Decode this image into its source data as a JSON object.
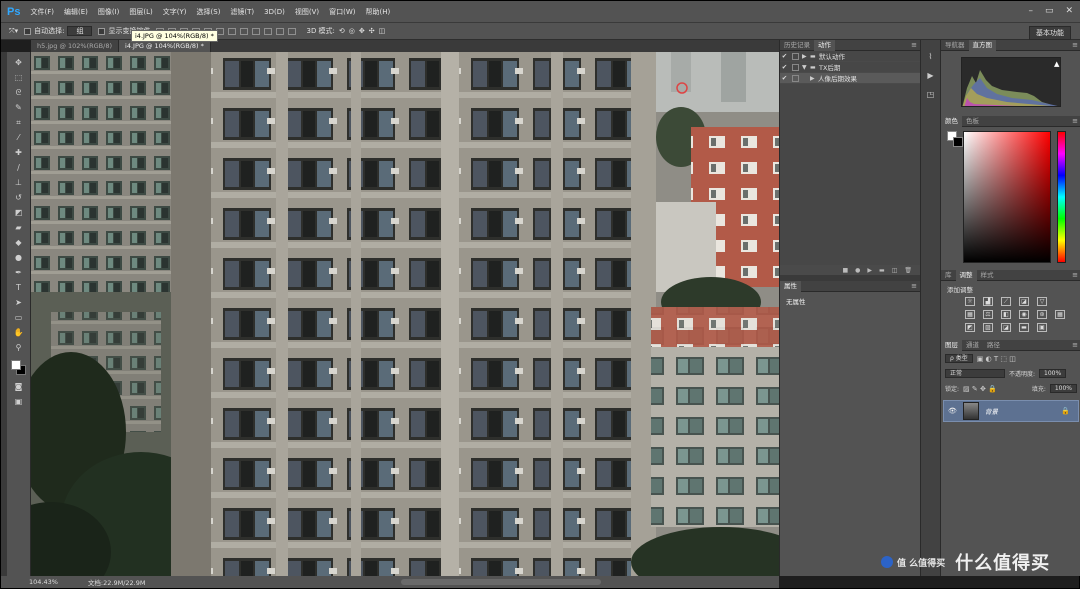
{
  "app": {
    "logo": "Ps"
  },
  "menu": [
    "文件(F)",
    "编辑(E)",
    "图像(I)",
    "图层(L)",
    "文字(Y)",
    "选择(S)",
    "滤镜(T)",
    "3D(D)",
    "视图(V)",
    "窗口(W)",
    "帮助(H)"
  ],
  "window_controls": [
    "–",
    "▭",
    "✕"
  ],
  "options": {
    "auto_select_label": "自动选择:",
    "auto_select_value": "组",
    "show_transform_label": "显示变换控件",
    "mode_3d_label": "3D 模式:",
    "workspace": "基本功能"
  },
  "tabs": [
    {
      "label": "h5.jpg @ 102%(RGB/8)",
      "active": false
    },
    {
      "label": "i4.JPG @ 104%(RGB/8) *",
      "active": true
    }
  ],
  "tooltip": "i4.JPG @ 104%(RGB/8) *",
  "status": {
    "zoom": "104.43%",
    "doc": "文档:22.9M/22.9M"
  },
  "history_panel": {
    "tabs": [
      "历史记录",
      "动作"
    ],
    "active_tab": "动作",
    "rows": [
      {
        "check": "✔",
        "expand": "▶",
        "label": "默认动作",
        "indent": false
      },
      {
        "check": "✔",
        "expand": "▼",
        "label": "TX后期",
        "indent": false
      },
      {
        "check": "✔",
        "expand": "▶",
        "label": "人像后期效果",
        "indent": true
      }
    ]
  },
  "properties_panel": {
    "title": "属性",
    "text": "无属性"
  },
  "navigator": {
    "tabs": [
      "导航器",
      "直方图"
    ],
    "active_tab": "直方图"
  },
  "color": {
    "tabs": [
      "颜色",
      "色板"
    ],
    "active_tab": "颜色"
  },
  "adjustments": {
    "tabs": [
      "库",
      "调整",
      "样式"
    ],
    "active_tab": "调整",
    "title": "添加调整"
  },
  "layers": {
    "tabs": [
      "图层",
      "通道",
      "路径"
    ],
    "active_tab": "图层",
    "filter": "ρ 类型",
    "blend_mode": "正常",
    "opacity_label": "不透明度:",
    "opacity_value": "100%",
    "lock_label": "锁定:",
    "fill_label": "填充:",
    "fill_value": "100%",
    "items": [
      {
        "name": "背景",
        "visible": true,
        "locked": true
      }
    ]
  },
  "watermark": {
    "text": "值 么值得买",
    "logo": "什么值得买"
  }
}
